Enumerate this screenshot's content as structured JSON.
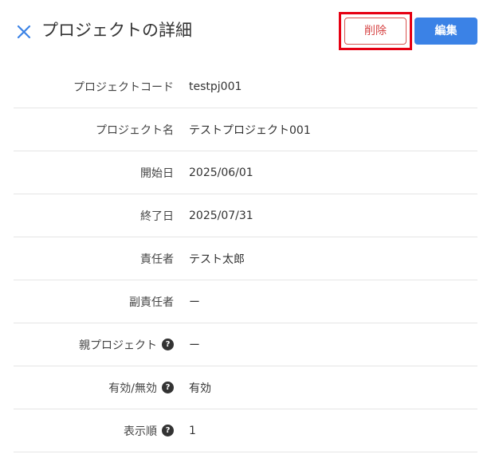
{
  "header": {
    "title": "プロジェクトの詳細",
    "delete_label": "削除",
    "edit_label": "編集"
  },
  "colors": {
    "accent": "#3b82e6",
    "danger": "#d64545",
    "highlight": "#e60012"
  },
  "icons": {
    "close": "close-icon",
    "help": "help-icon"
  },
  "fields": [
    {
      "label": "プロジェクトコード",
      "value": "testpj001",
      "help": false
    },
    {
      "label": "プロジェクト名",
      "value": "テストプロジェクト001",
      "help": false
    },
    {
      "label": "開始日",
      "value": "2025/06/01",
      "help": false
    },
    {
      "label": "終了日",
      "value": "2025/07/31",
      "help": false
    },
    {
      "label": "責任者",
      "value": "テスト太郎",
      "help": false
    },
    {
      "label": "副責任者",
      "value": "ー",
      "help": false
    },
    {
      "label": "親プロジェクト",
      "value": "ー",
      "help": true
    },
    {
      "label": "有効/無効",
      "value": "有効",
      "help": true
    },
    {
      "label": "表示順",
      "value": "1",
      "help": true
    }
  ],
  "help_glyph": "?"
}
